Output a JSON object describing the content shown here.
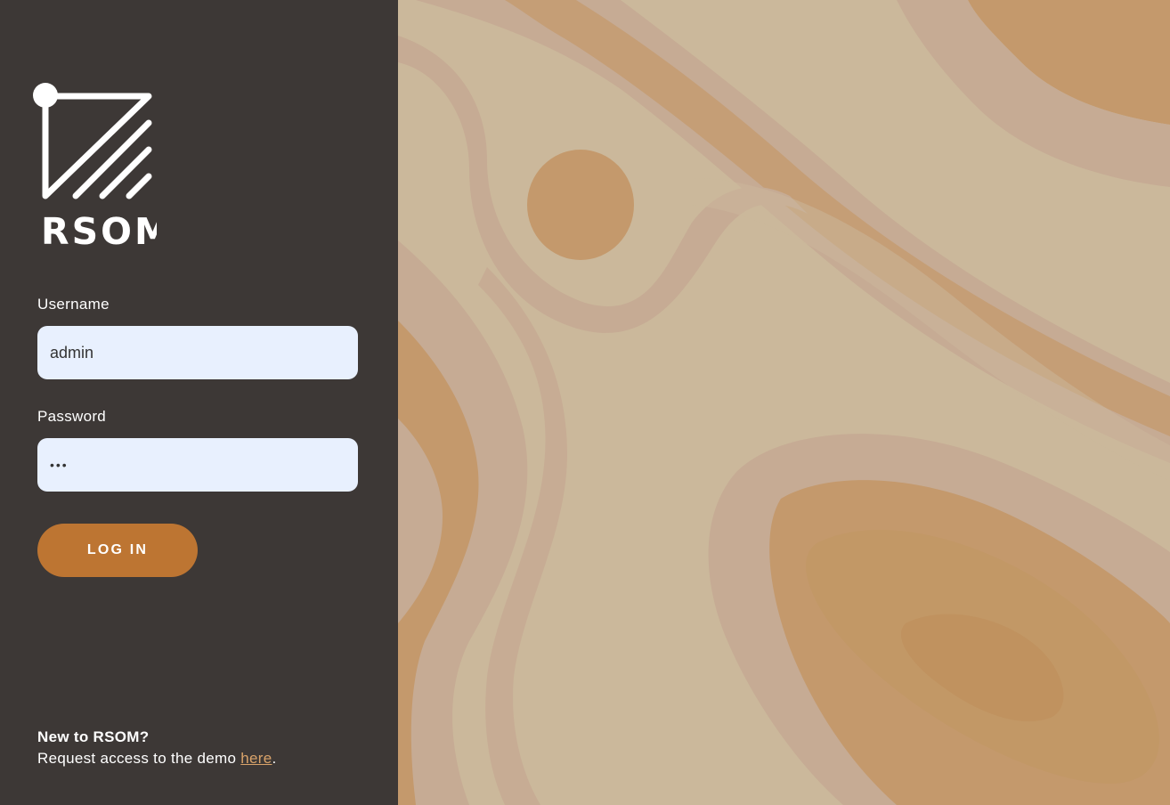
{
  "brand": {
    "name": "RSOM",
    "logo_icon": "rsom-logo-icon"
  },
  "login_form": {
    "username_label": "Username",
    "username_value": "admin",
    "password_label": "Password",
    "password_value": "•••",
    "submit_label": "LOG IN"
  },
  "footer": {
    "heading": "New to RSOM?",
    "text_before_link": "Request access to the demo ",
    "link_label": "here",
    "text_after_link": "."
  },
  "colors": {
    "sidebar_background": "#3d3836",
    "accent": "#bd7532",
    "link": "#d9a36a",
    "input_background": "#e8f0fe",
    "map_light": "#cbb89b",
    "map_mid": "#c6ab94",
    "map_dark": "#c4996c"
  },
  "background": {
    "icon": "topographic-map-background"
  }
}
